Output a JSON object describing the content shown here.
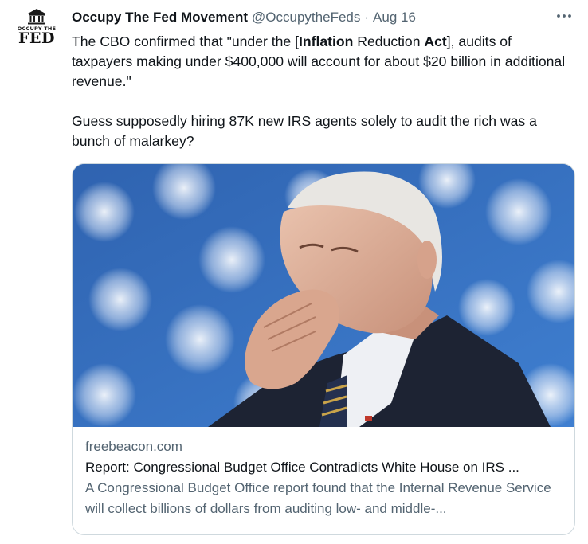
{
  "author": {
    "avatar_small_text": "OCCUPY THE",
    "avatar_big_text": "FED",
    "display_name": "Occupy The Fed Movement",
    "handle": "@OccupytheFeds",
    "separator": "·",
    "date": "Aug 16"
  },
  "more_icon": "more-horizontal-icon",
  "tweet": {
    "p1_a": "The CBO confirmed that \"under the [",
    "p1_b": "Inflation",
    "p1_c": " Reduction ",
    "p1_d": "Act",
    "p1_e": "], audits of taxpayers making under $400,000 will account for about $20 billion in additional revenue.\"",
    "p2": "Guess supposedly hiring 87K new IRS agents solely to audit the rich was a bunch of malarkey?"
  },
  "card": {
    "domain": "freebeacon.com",
    "title": "Report: Congressional Budget Office Contradicts White House on IRS ...",
    "description": "A Congressional Budget Office report found that the Internal Revenue Service will collect billions of dollars from auditing low- and middle-..."
  },
  "colors": {
    "text": "#0f1419",
    "secondary": "#536471",
    "border": "#cfd9de",
    "image_bg": "#3a6fb8"
  }
}
